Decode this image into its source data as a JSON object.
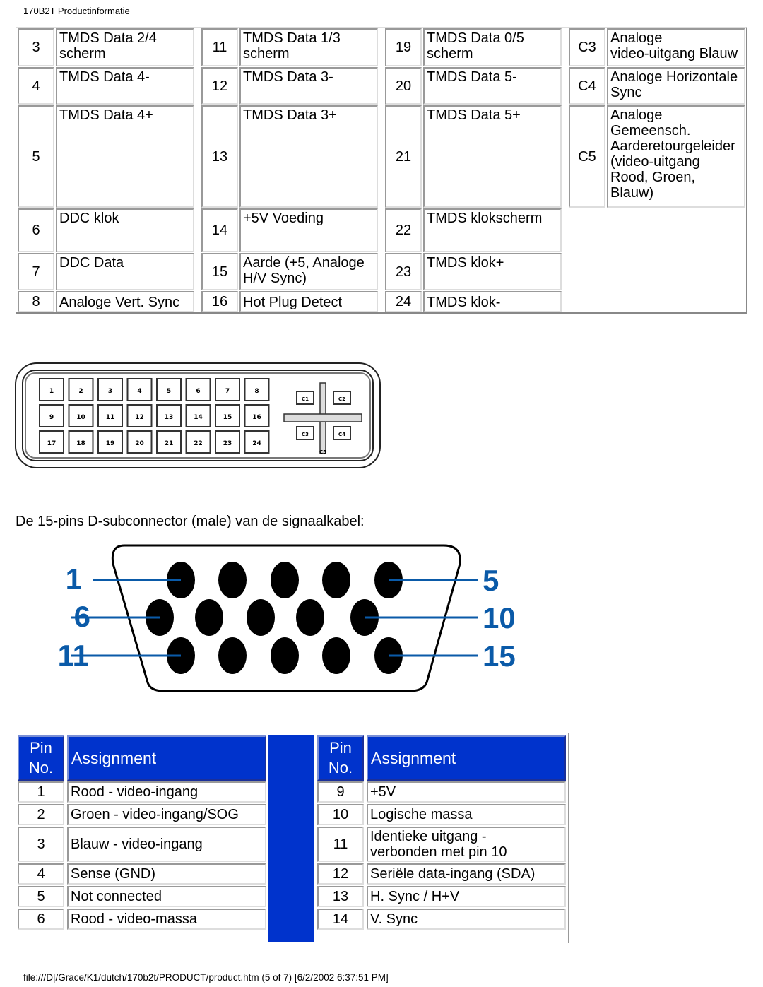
{
  "header": {
    "title": "170B2T Productinformatie"
  },
  "dvi_table": {
    "columns": [
      {
        "rows": [
          {
            "pin": "3",
            "label": "TMDS Data 2/4\nscherm"
          },
          {
            "pin": "4",
            "label": "TMDS Data 4-"
          },
          {
            "pin": "5",
            "label": "TMDS Data 4+"
          },
          {
            "pin": "6",
            "label": "DDC klok"
          },
          {
            "pin": "7",
            "label": "DDC Data"
          },
          {
            "pin": "8",
            "label": "Analoge Vert. Sync"
          }
        ]
      },
      {
        "rows": [
          {
            "pin": "11",
            "label": "TMDS Data 1/3\nscherm"
          },
          {
            "pin": "12",
            "label": "TMDS Data 3-"
          },
          {
            "pin": "13",
            "label": "TMDS Data 3+"
          },
          {
            "pin": "14",
            "label": "+5V Voeding"
          },
          {
            "pin": "15",
            "label": "Aarde (+5, Analoge\nH/V Sync)"
          },
          {
            "pin": "16",
            "label": "Hot Plug Detect"
          }
        ]
      },
      {
        "rows": [
          {
            "pin": "19",
            "label": "TMDS Data 0/5\nscherm"
          },
          {
            "pin": "20",
            "label": "TMDS Data 5-"
          },
          {
            "pin": "21",
            "label": "TMDS Data 5+"
          },
          {
            "pin": "22",
            "label": "TMDS klokscherm"
          },
          {
            "pin": "23",
            "label": "TMDS klok+"
          },
          {
            "pin": "24",
            "label": "TMDS klok-"
          }
        ]
      },
      {
        "rows": [
          {
            "pin": "C3",
            "label": "Analoge\nvideo-uitgang Blauw"
          },
          {
            "pin": "C4",
            "label": "Analoge Horizontale\nSync"
          },
          {
            "pin": "C5",
            "label": "Analoge\nGemeensch.\nAarderetourgeleider\n(video-uitgang\nRood, Groen,\nBlauw)"
          }
        ]
      }
    ]
  },
  "dvi_connector": {
    "pins": [
      "1",
      "2",
      "3",
      "4",
      "5",
      "6",
      "7",
      "8",
      "9",
      "10",
      "11",
      "12",
      "13",
      "14",
      "15",
      "16",
      "17",
      "18",
      "19",
      "20",
      "21",
      "22",
      "23",
      "24"
    ],
    "analog": [
      "C1",
      "C2",
      "C3",
      "C4",
      "C5"
    ]
  },
  "paragraph": "De 15-pins D-subconnector (male) van de signaalkabel:",
  "vga_connector": {
    "labels": {
      "l1": "1",
      "l6": "6",
      "l11": "11",
      "r5": "5",
      "r10": "10",
      "r15": "15"
    },
    "label_color": "#0a5aa8"
  },
  "vga_table": {
    "header_color": "#0033cc",
    "headers": {
      "pin": "Pin\nNo.",
      "assignment": "Assignment"
    },
    "left": [
      {
        "pin": "1",
        "label": "Rood - video-ingang"
      },
      {
        "pin": "2",
        "label": "Groen - video-ingang/SOG"
      },
      {
        "pin": "3",
        "label": "Blauw - video-ingang"
      },
      {
        "pin": "4",
        "label": "Sense (GND)"
      },
      {
        "pin": "5",
        "label": "Not connected"
      },
      {
        "pin": "6",
        "label": "Rood - video-massa"
      }
    ],
    "right": [
      {
        "pin": "9",
        "label": "+5V"
      },
      {
        "pin": "10",
        "label": "Logische massa"
      },
      {
        "pin": "11",
        "label": "Identieke uitgang -\nverbonden met pin 10"
      },
      {
        "pin": "12",
        "label": "Seriële data-ingang (SDA)"
      },
      {
        "pin": "13",
        "label": "H. Sync / H+V"
      },
      {
        "pin": "14",
        "label": "V. Sync"
      }
    ]
  },
  "footer": {
    "text": "file:///D|/Grace/K1/dutch/170b2t/PRODUCT/product.htm (5 of 7) [6/2/2002 6:37:51 PM]"
  }
}
